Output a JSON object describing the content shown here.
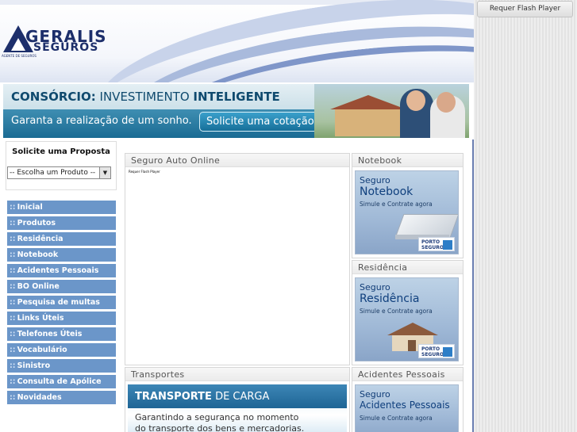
{
  "brand": {
    "logo_word1": "GERALIS",
    "logo_word2": "SEGUROS",
    "logo_tagline": "AGENTE DE SEGUROS"
  },
  "banner": {
    "headline_bold1": "CONSÓRCIO:",
    "headline_mid": " INVESTIMENTO ",
    "headline_bold2": "INTELIGENTE",
    "subtitle": "Garanta a realização de um sonho.",
    "cta": "Solicite uma cotação"
  },
  "proposta": {
    "title": "Solicite uma Proposta",
    "select_value": "-- Escolha um Produto --",
    "select_arrow": "▼"
  },
  "menu": {
    "bullet": "::",
    "items": [
      "Inicial",
      "Produtos",
      "Residência",
      "Notebook",
      "Acidentes Pessoais",
      "BO Online",
      "Pesquisa de multas",
      "Links Úteis",
      "Telefones Úteis",
      "Vocabulário",
      "Sinistro",
      "Consulta de Apólice",
      "Novidades"
    ]
  },
  "panels": {
    "auto": {
      "title": "Seguro Auto Online",
      "flash_msg": "Requer Flash Player"
    },
    "notebook": {
      "title": "Notebook",
      "ad_line1": "Seguro",
      "ad_line2": "Notebook",
      "ad_line3": "Simule e Contrate agora",
      "ad_brand1": "PORTO",
      "ad_brand2": "SEGURO"
    },
    "residencia": {
      "title": "Residência",
      "ad_line1": "Seguro",
      "ad_line2": "Residência",
      "ad_line3": "Simule e Contrate agora",
      "ad_brand1": "PORTO",
      "ad_brand2": "SEGURO"
    },
    "transportes": {
      "title": "Transportes",
      "ad_bold": "TRANSPORTE",
      "ad_rest": " DE CARGA",
      "ad_line2": "Garantindo a segurança no momento",
      "ad_line3": "do transporte dos bens e mercadorias."
    },
    "acidentes": {
      "title": "Acidentes Pessoais",
      "ad_line1": "Seguro",
      "ad_line2": "Acidentes Pessoais",
      "ad_line3": "Simule e Contrate agora"
    }
  },
  "flash_side": {
    "button": "Requer Flash Player"
  },
  "colors": {
    "menu_item_bg": "#6b96c9",
    "logo_blue": "#1d2f6b",
    "banner_teal": "#1a6b93"
  }
}
